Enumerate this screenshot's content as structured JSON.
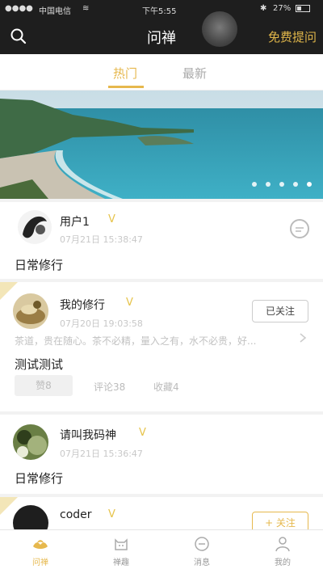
{
  "status_bar": {
    "carrier": "中国电信",
    "time": "下午5:55",
    "battery": "27%"
  },
  "nav": {
    "title": "问禅",
    "ask_button": "免费提问"
  },
  "tabs": [
    {
      "label": "热门",
      "active": true
    },
    {
      "label": "最新",
      "active": false
    }
  ],
  "banner": {
    "dots": 5,
    "active_dot": 5
  },
  "posts": [
    {
      "name": "用户1",
      "vip": "V",
      "time": "07月21日 15:38:47",
      "text": "日常修行"
    },
    {
      "name": "我的修行",
      "vip": "V",
      "time": "07月20日 19:03:58",
      "follow": "已关注",
      "excerpt": "茶道，贵在随心。茶不必精，量入之有，水不必贵，好...",
      "text": "测试测试",
      "actions": [
        "赞8",
        "评论38",
        "收藏4"
      ]
    },
    {
      "name": "请叫我码神",
      "vip": "V",
      "time": "07月21日 15:36:47",
      "text": "日常修行"
    },
    {
      "name": "coder",
      "vip": "V",
      "follow": "+ 关注"
    }
  ],
  "tabbar": [
    {
      "label": "问禅",
      "active": true,
      "icon": "lotus-icon"
    },
    {
      "label": "禅趣",
      "active": false,
      "icon": "cat-icon"
    },
    {
      "label": "消息",
      "active": false,
      "icon": "chat-icon"
    },
    {
      "label": "我的",
      "active": false,
      "icon": "person-icon"
    }
  ],
  "colors": {
    "accent": "#e6b84d",
    "nav_bg": "#1e1e1e"
  }
}
